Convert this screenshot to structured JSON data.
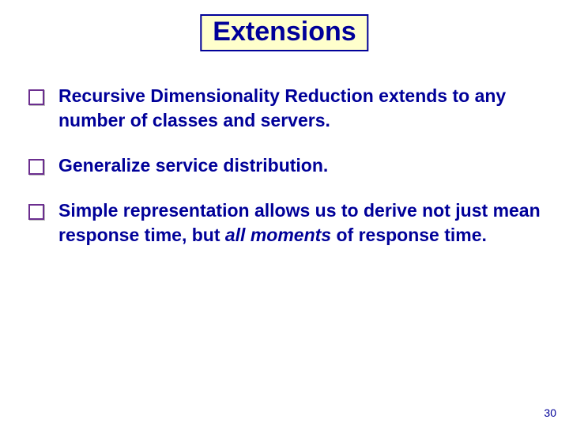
{
  "title": "Extensions",
  "bullets": [
    {
      "text": "Recursive Dimensionality Reduction extends to any number of classes and servers."
    },
    {
      "text": "Generalize service distribution."
    },
    {
      "text": "Simple representation allows us to derive not just mean response time, but <em>all moments</em> of response time."
    }
  ],
  "page_number": "30"
}
